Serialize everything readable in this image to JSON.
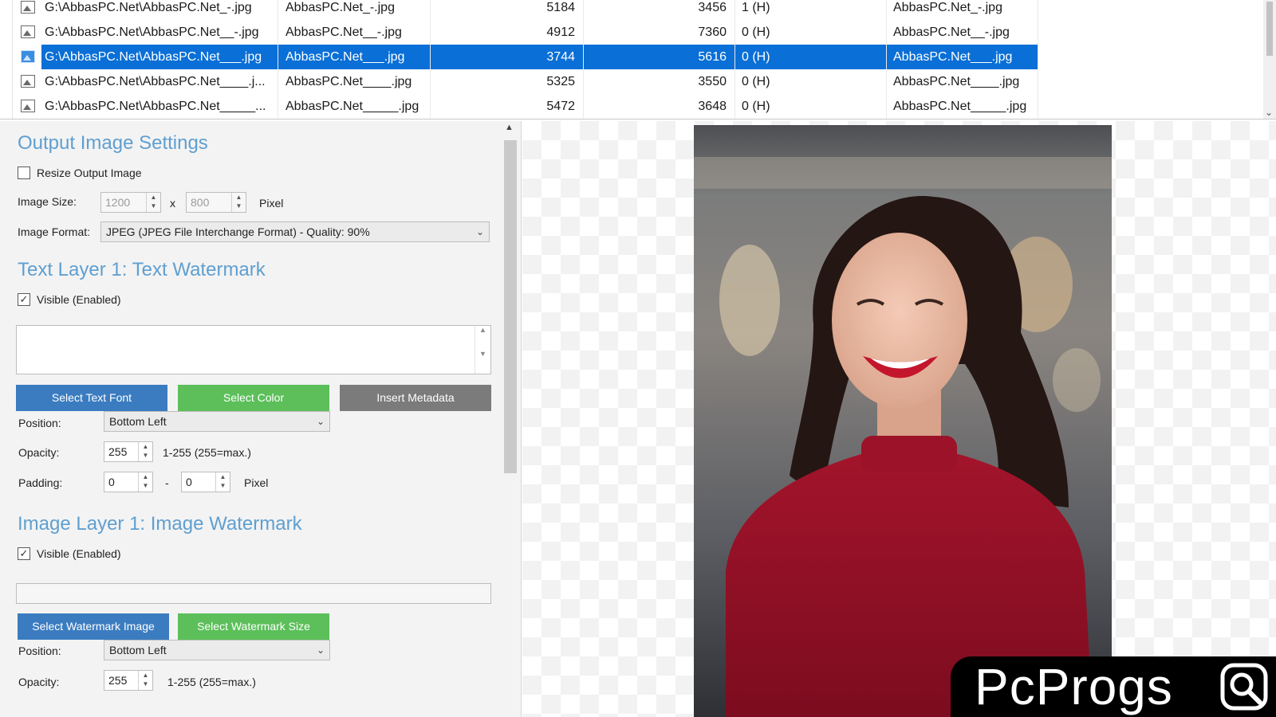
{
  "file_list": {
    "rows": [
      {
        "path": "G:\\AbbasPC.Net\\AbbasPC.Net_-.jpg",
        "name": "AbbasPC.Net_-.jpg",
        "width": "5184",
        "height": "3456",
        "orientation": "1 (H)",
        "output": "AbbasPC.Net_-.jpg",
        "selected": false
      },
      {
        "path": "G:\\AbbasPC.Net\\AbbasPC.Net__-.jpg",
        "name": "AbbasPC.Net__-.jpg",
        "width": "4912",
        "height": "7360",
        "orientation": "0 (H)",
        "output": "AbbasPC.Net__-.jpg",
        "selected": false
      },
      {
        "path": "G:\\AbbasPC.Net\\AbbasPC.Net___.jpg",
        "name": "AbbasPC.Net___.jpg",
        "width": "3744",
        "height": "5616",
        "orientation": "0 (H)",
        "output": "AbbasPC.Net___.jpg",
        "selected": true
      },
      {
        "path": "G:\\AbbasPC.Net\\AbbasPC.Net____.j...",
        "name": "AbbasPC.Net____.jpg",
        "width": "5325",
        "height": "3550",
        "orientation": "0 (H)",
        "output": "AbbasPC.Net____.jpg",
        "selected": false
      },
      {
        "path": "G:\\AbbasPC.Net\\AbbasPC.Net_____...",
        "name": "AbbasPC.Net_____.jpg",
        "width": "5472",
        "height": "3648",
        "orientation": "0 (H)",
        "output": "AbbasPC.Net_____.jpg",
        "selected": false
      }
    ]
  },
  "output_settings": {
    "title": "Output Image Settings",
    "resize_label": "Resize Output Image",
    "resize_checked": false,
    "image_size_label": "Image Size:",
    "width_value": "1200",
    "height_value": "800",
    "size_separator": "x",
    "size_unit": "Pixel",
    "format_label": "Image Format:",
    "format_value": "JPEG (JPEG File Interchange Format) - Quality: 90%"
  },
  "text_layer": {
    "title": "Text Layer 1: Text Watermark",
    "visible_label": "Visible (Enabled)",
    "visible_checked": true,
    "text_value": "",
    "select_font_label": "Select Text Font",
    "select_color_label": "Select Color",
    "insert_metadata_label": "Insert Metadata",
    "position_label": "Position:",
    "position_value": "Bottom Left",
    "opacity_label": "Opacity:",
    "opacity_value": "255",
    "opacity_hint": "1-255 (255=max.)",
    "padding_label": "Padding:",
    "padding_x": "0",
    "padding_separator": "-",
    "padding_y": "0",
    "padding_unit": "Pixel"
  },
  "image_layer": {
    "title": "Image Layer 1: Image Watermark",
    "visible_label": "Visible (Enabled)",
    "visible_checked": true,
    "watermark_path": "",
    "select_image_label": "Select Watermark Image",
    "select_size_label": "Select Watermark Size",
    "position_label": "Position:",
    "position_value": "Bottom Left",
    "opacity_label": "Opacity:",
    "opacity_value": "255",
    "opacity_hint": "1-255 (255=max.)"
  },
  "logo": {
    "text": "PcProgs"
  },
  "colors": {
    "accent": "#5f9fd0",
    "selection": "#0a6fd6",
    "button_blue": "#3b7cc0",
    "button_green": "#5cbf5a",
    "button_gray": "#7b7b7b"
  },
  "icons": {
    "file_icon": "image-file-icon",
    "check": "checkmark-icon",
    "dropdown": "chevron-down-icon",
    "logo_icon": "magnifier-icon"
  }
}
